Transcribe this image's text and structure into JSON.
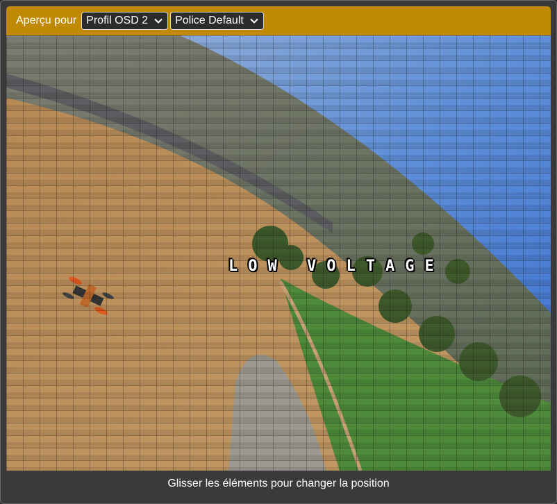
{
  "header": {
    "label": "Aperçu pour",
    "profile_select": {
      "value": "Profil OSD 2"
    },
    "font_select": {
      "value": "Police Default"
    }
  },
  "preview": {
    "osd_elements": [
      {
        "text": "LOW VOLTAGE"
      }
    ]
  },
  "footer": {
    "hint": "Glisser les éléments pour changer la position"
  },
  "colors": {
    "header_bg": "#c08a05",
    "panel_bg": "#393939",
    "select_bg": "#2b2b2b"
  }
}
